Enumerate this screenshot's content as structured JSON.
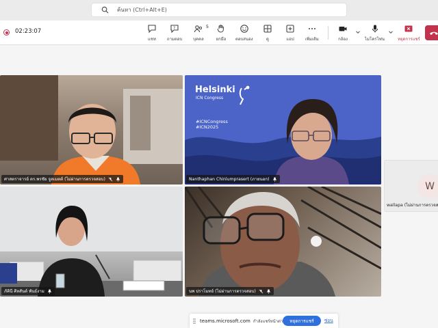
{
  "search": {
    "placeholder": "ค้นหา (Ctrl+Alt+E)"
  },
  "meeting": {
    "timer": "02:23:07"
  },
  "toolbar": {
    "chat": "แชท",
    "qa": "ถามตอบ",
    "people": "บุคคล",
    "people_count": "5",
    "raise": "ยกมือ",
    "react": "ตอบสนอง",
    "view": "ดู",
    "apps": "แอป",
    "more": "เพิ่มเติม",
    "camera": "กล้อง",
    "mic": "ไมโครโฟน",
    "stop_share": "หยุดการแชร์"
  },
  "tiles": [
    {
      "name": "ศาสตราจารย์ ดร.พรชัย จูลเมตต์ (ไม่ผ่านการตรวจสอบ)"
    },
    {
      "name": "Nanthaphan Chinlumprasert (ภายนอก)"
    },
    {
      "name": "ภัคินี ศิลสันต์ พันธ์งาม"
    },
    {
      "name": "นพ ปราโมทย์ (ไม่ผ่านการตรวจสอบ)"
    }
  ],
  "slide": {
    "title": "Helsinki",
    "subtitle_1": "ICN Congress",
    "tag_1": "#ICNCongress",
    "tag_2": "#ICN2025"
  },
  "side_participant": {
    "initial": "W",
    "name": "wallapa (ไม่ผ่านการตรวจสอบ)"
  },
  "share_bar": {
    "domain": "teams.microsoft.com",
    "message": "กำลังแชร์หน้าต่าง",
    "stop_label": "หยุดการแชร์",
    "hide_label": "ซ่อน"
  },
  "colors": {
    "accent": "#2f6fde",
    "danger": "#c4314b",
    "slide_bg": "#4c63c8"
  }
}
